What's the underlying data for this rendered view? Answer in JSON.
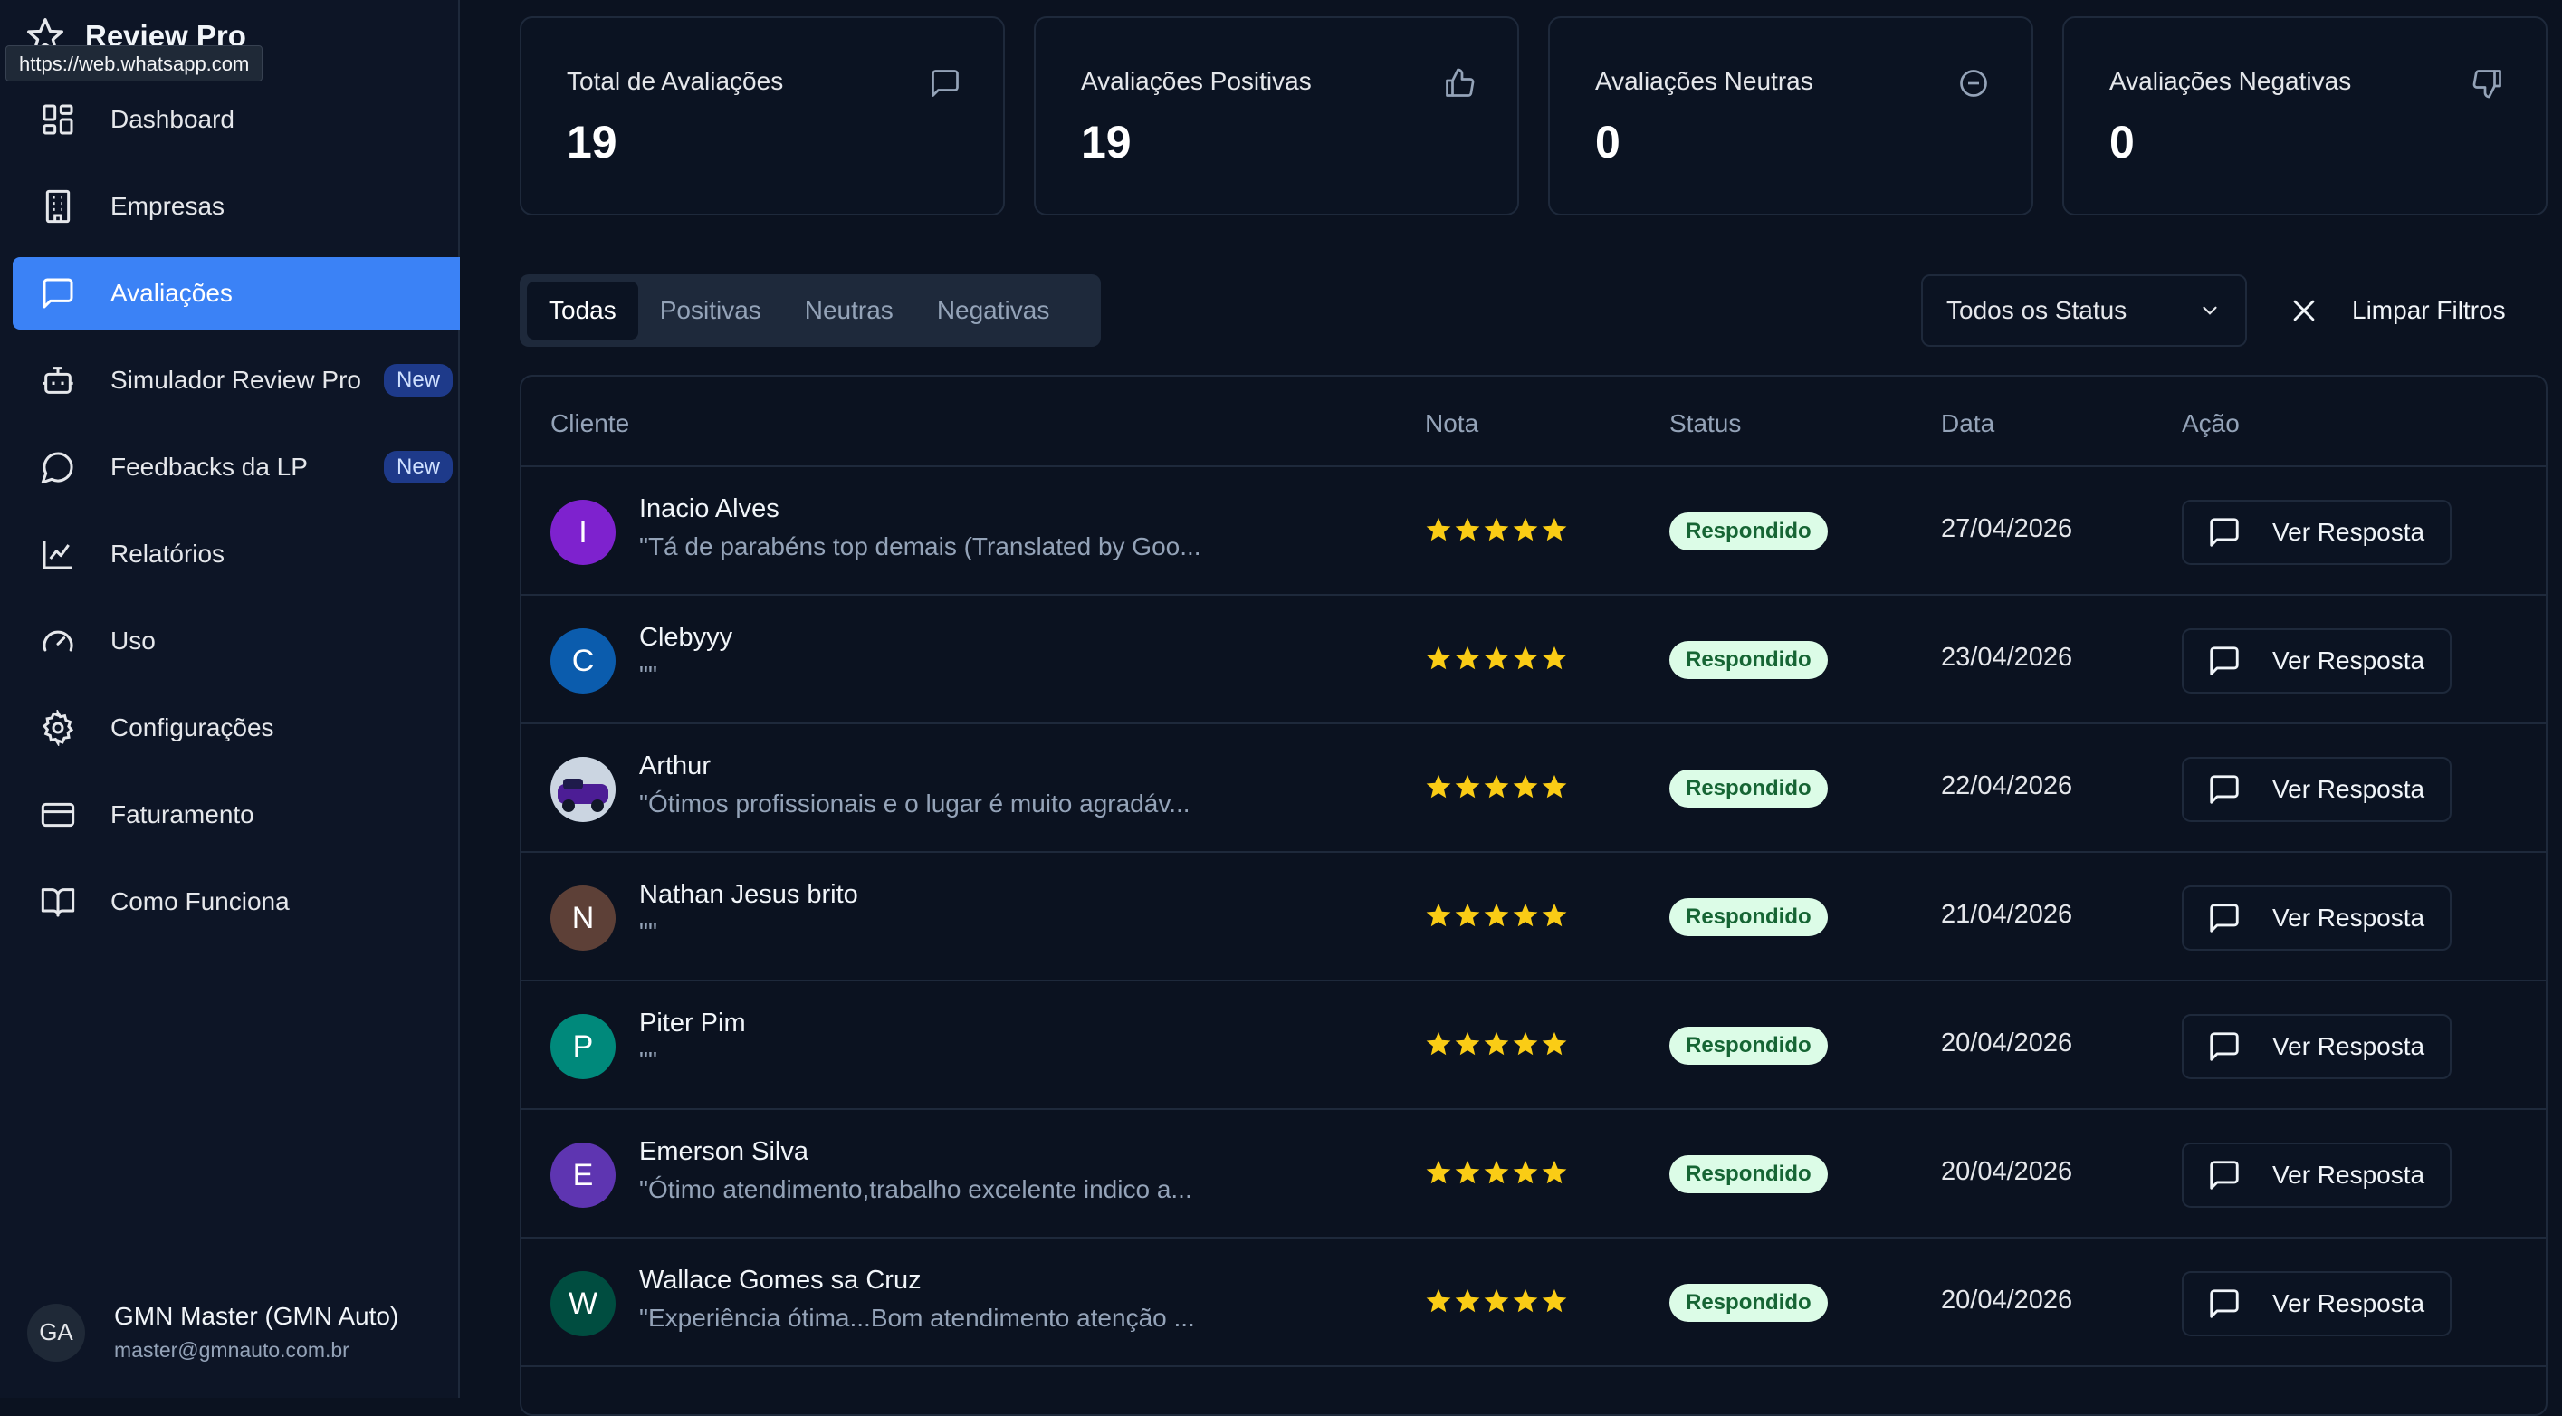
{
  "brand": {
    "name": "Review Pro"
  },
  "tooltip": {
    "url": "https://web.whatsapp.com"
  },
  "nav": [
    {
      "label": "Dashboard",
      "icon": "dashboard-icon"
    },
    {
      "label": "Empresas",
      "icon": "building-icon"
    },
    {
      "label": "Avaliações",
      "icon": "message-square-icon",
      "active": true
    },
    {
      "label": "Simulador Review Pro",
      "icon": "bot-icon",
      "badge": "New"
    },
    {
      "label": "Feedbacks da LP",
      "icon": "message-circle-icon",
      "badge": "New"
    },
    {
      "label": "Relatórios",
      "icon": "chart-icon"
    },
    {
      "label": "Uso",
      "icon": "gauge-icon"
    },
    {
      "label": "Configurações",
      "icon": "gear-icon"
    },
    {
      "label": "Faturamento",
      "icon": "credit-card-icon"
    },
    {
      "label": "Como Funciona",
      "icon": "book-icon"
    }
  ],
  "user": {
    "initials": "GA",
    "name": "GMN Master (GMN Auto)",
    "email": "master@gmnauto.com.br"
  },
  "stats": [
    {
      "label": "Total de Avaliações",
      "value": "19",
      "icon": "message-square-icon"
    },
    {
      "label": "Avaliações Positivas",
      "value": "19",
      "icon": "thumbs-up-icon"
    },
    {
      "label": "Avaliações Neutras",
      "value": "0",
      "icon": "minus-circle-icon"
    },
    {
      "label": "Avaliações Negativas",
      "value": "0",
      "icon": "thumbs-down-icon"
    }
  ],
  "filters": {
    "tabs": [
      "Todas",
      "Positivas",
      "Neutras",
      "Negativas"
    ],
    "active_tab": "Todas",
    "status_select": "Todos os Status",
    "clear_label": "Limpar Filtros"
  },
  "table": {
    "headers": {
      "cliente": "Cliente",
      "nota": "Nota",
      "status": "Status",
      "data": "Data",
      "acao": "Ação"
    },
    "action_label": "Ver Resposta",
    "star_color": "#facc15",
    "rows": [
      {
        "initial": "I",
        "avatar_color": "#7e22ce",
        "name": "Inacio Alves",
        "comment": "\"Tá de parabéns top demais (Translated by Goo...",
        "rating": 5,
        "status": "Respondido",
        "date": "27/04/2026"
      },
      {
        "initial": "C",
        "avatar_color": "#0b5cad",
        "name": "Clebyyy",
        "comment": "\"\"",
        "rating": 5,
        "status": "Respondido",
        "date": "23/04/2026"
      },
      {
        "initial": "",
        "avatar_color": "#334155",
        "photo": true,
        "name": "Arthur",
        "comment": "\"Ótimos profissionais e o lugar é muito agradáv...",
        "rating": 5,
        "status": "Respondido",
        "date": "22/04/2026"
      },
      {
        "initial": "N",
        "avatar_color": "#5d4037",
        "name": "Nathan Jesus brito",
        "comment": "\"\"",
        "rating": 5,
        "status": "Respondido",
        "date": "21/04/2026"
      },
      {
        "initial": "P",
        "avatar_color": "#00897b",
        "name": "Piter Pim",
        "comment": "\"\"",
        "rating": 5,
        "status": "Respondido",
        "date": "20/04/2026"
      },
      {
        "initial": "E",
        "avatar_color": "#5e35b1",
        "name": "Emerson Silva",
        "comment": "\"Ótimo atendimento,trabalho excelente indico a...",
        "rating": 5,
        "status": "Respondido",
        "date": "20/04/2026"
      },
      {
        "initial": "W",
        "avatar_color": "#004d40",
        "name": "Wallace Gomes sa Cruz",
        "comment": "\"Experiência ótima...Bom atendimento atenção ...",
        "rating": 5,
        "status": "Respondido",
        "date": "20/04/2026"
      }
    ]
  }
}
